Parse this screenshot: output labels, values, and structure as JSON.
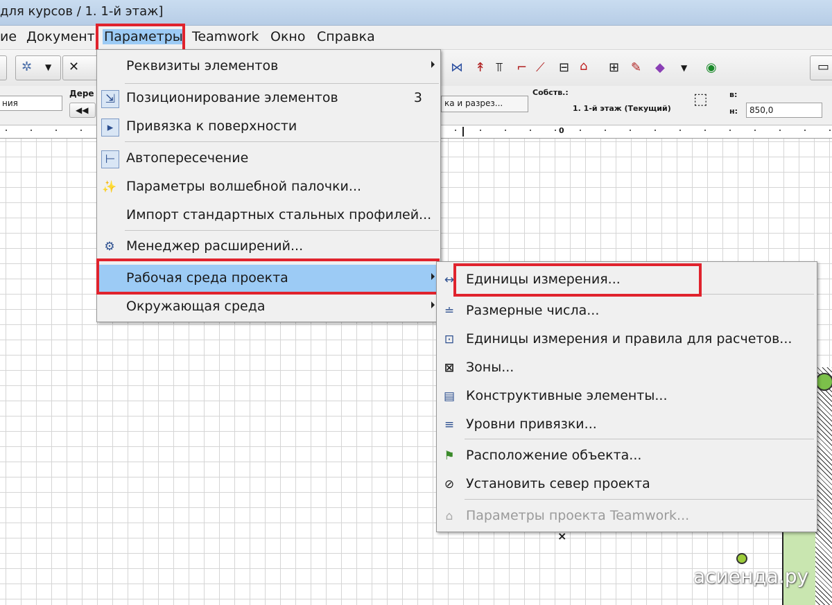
{
  "window": {
    "title": "для курсов / 1. 1-й этаж]"
  },
  "menubar": {
    "items": [
      "ие",
      "Документ",
      "Параметры",
      "Teamwork",
      "Окно",
      "Справка"
    ]
  },
  "infobox": {
    "left_field": "ния",
    "group_label": "Дере",
    "section_field": "ка и разрез...",
    "story_label": "Собств.:",
    "story_value": "1. 1-й этаж (Текущий)",
    "height_top_label": "в:",
    "height_bottom_label": "н:",
    "height_value": "850,0"
  },
  "ruler": {
    "zero_label": "0"
  },
  "params_menu": {
    "items": [
      {
        "label": "Реквизиты элементов",
        "submenu": true
      },
      {
        "label": "Позиционирование элементов",
        "shortcut": "3",
        "submenu": true
      },
      {
        "label": "Привязка к поверхности"
      },
      {
        "label": "Автопересечение"
      },
      {
        "label": "Параметры волшебной палочки..."
      },
      {
        "label": "Импорт стандартных стальных профилей..."
      },
      {
        "label": "Менеджер расширений..."
      },
      {
        "label": "Рабочая среда проекта",
        "submenu": true,
        "highlighted": true
      },
      {
        "label": "Окружающая среда",
        "submenu": true
      }
    ]
  },
  "project_pref_submenu": {
    "items": [
      {
        "label": "Единицы измерения..."
      },
      {
        "label": "Размерные числа..."
      },
      {
        "label": "Единицы измерения и правила для расчетов..."
      },
      {
        "label": "Зоны..."
      },
      {
        "label": "Конструктивные  элементы..."
      },
      {
        "label": "Уровни привязки..."
      },
      {
        "label": "Расположение объекта..."
      },
      {
        "label": "Установить север проекта"
      },
      {
        "label": "Параметры проекта Teamwork...",
        "disabled": true
      }
    ]
  },
  "watermark": "асиенда.ру",
  "colors": {
    "highlight": "#9ccbf5",
    "annotation_red": "#e0232d"
  }
}
